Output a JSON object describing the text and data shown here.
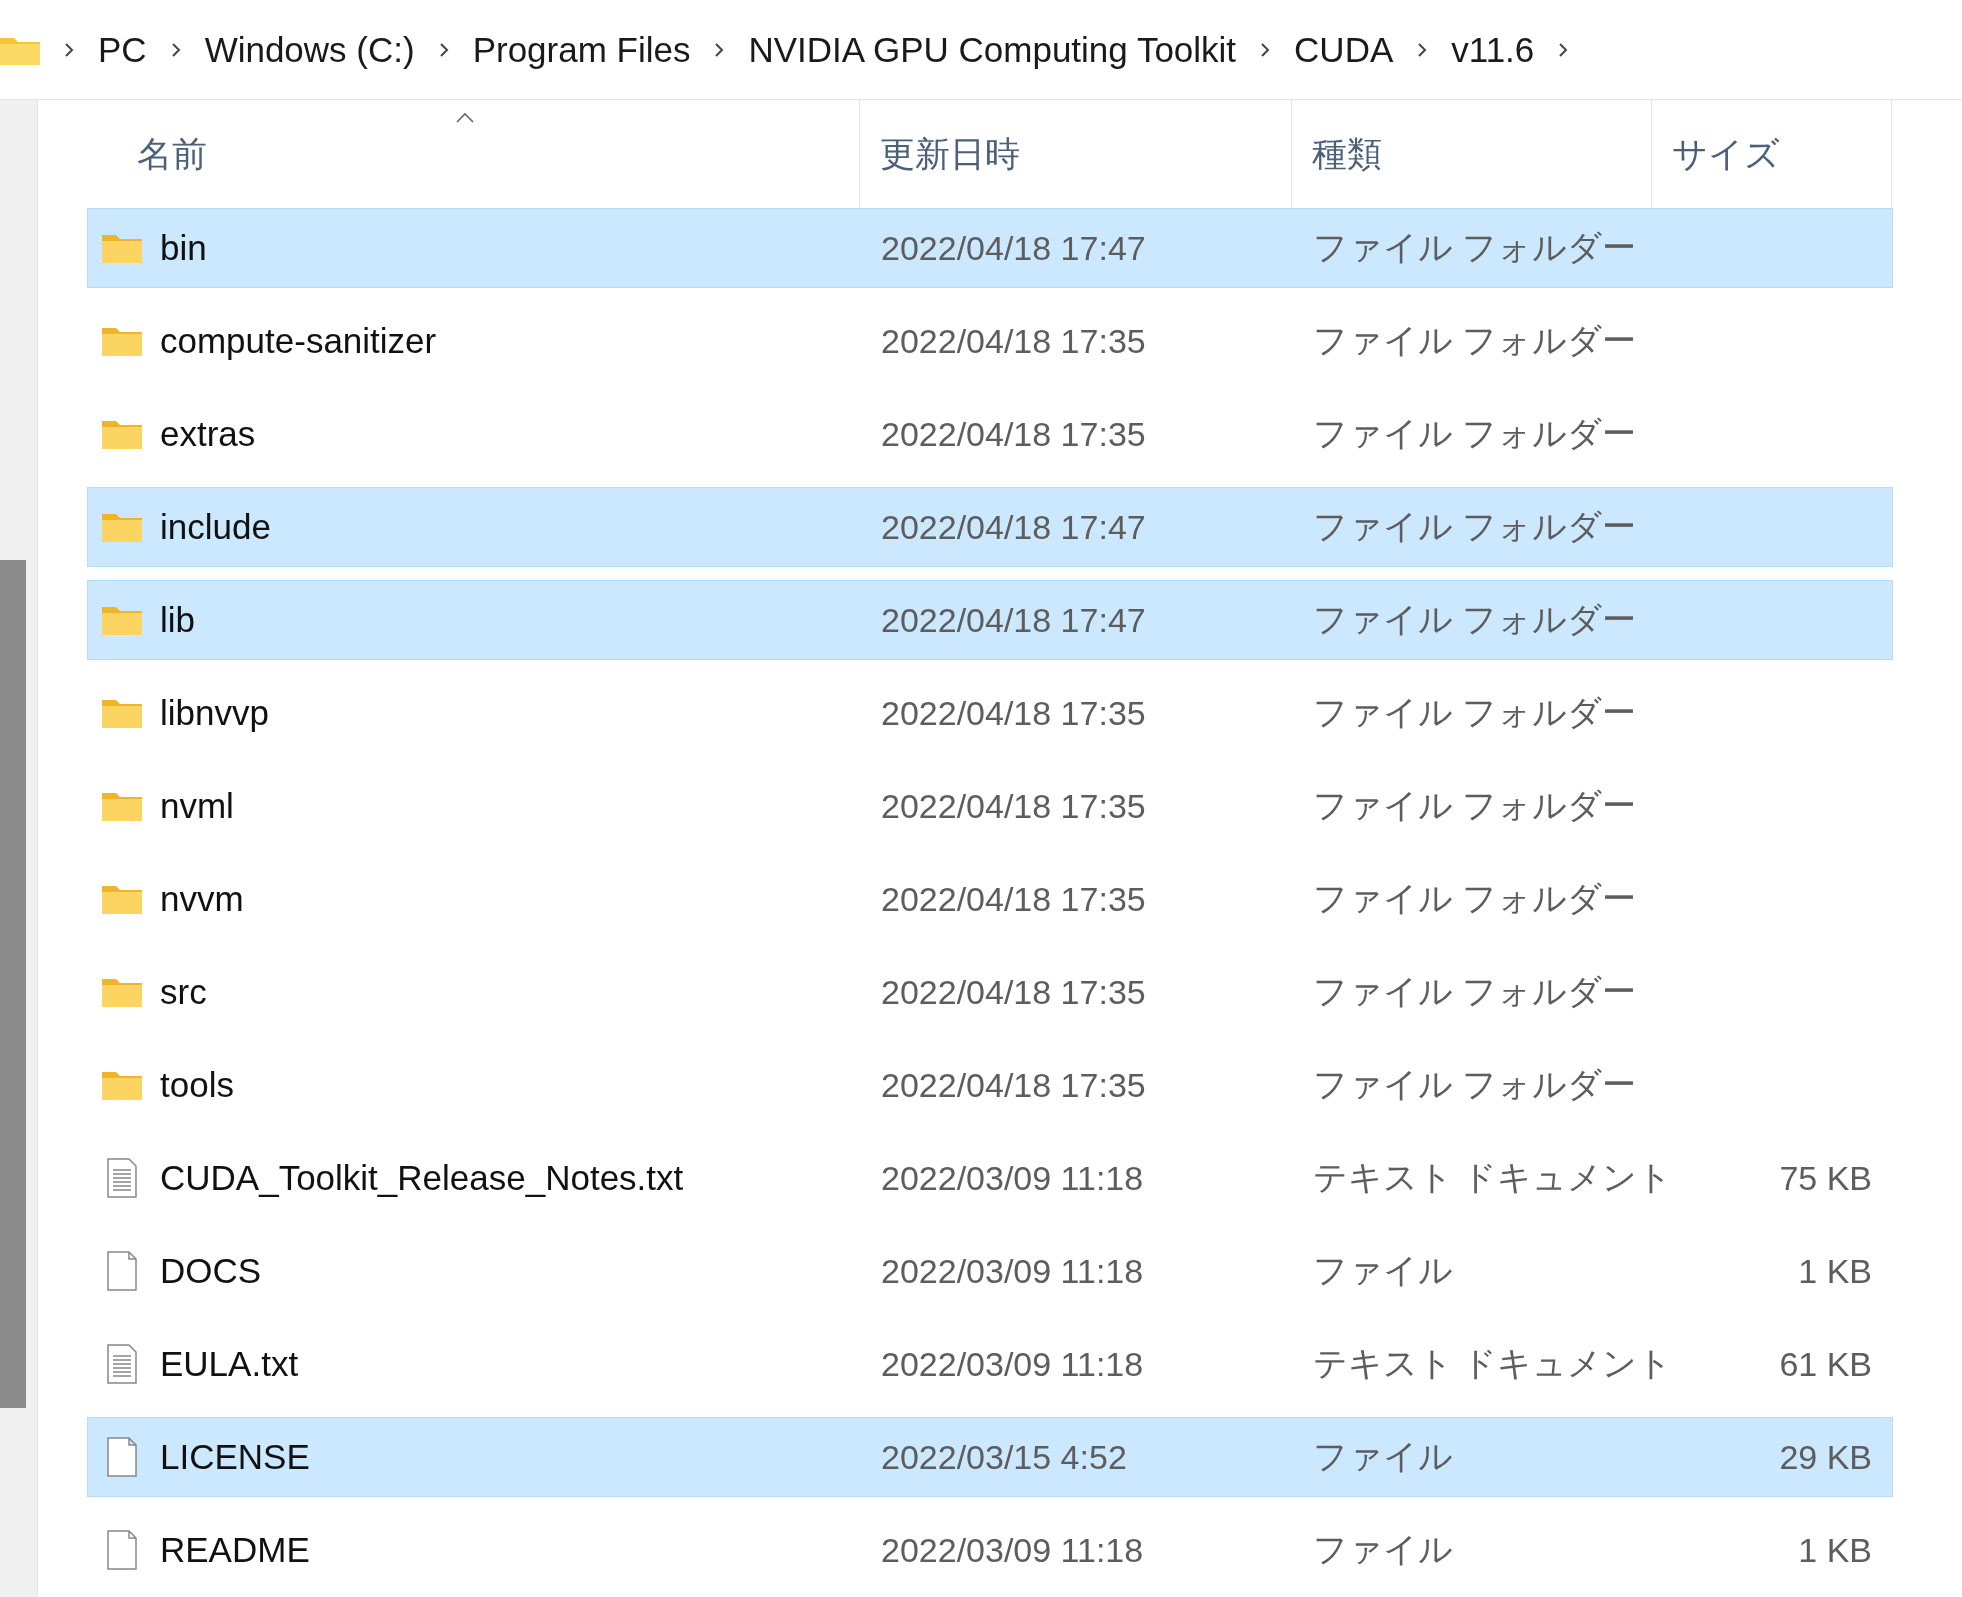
{
  "breadcrumb": [
    "PC",
    "Windows (C:)",
    "Program Files",
    "NVIDIA GPU Computing Toolkit",
    "CUDA",
    "v11.6"
  ],
  "table": {
    "columns": [
      {
        "label": "名前",
        "sorted": true
      },
      {
        "label": "更新日時",
        "sorted": false
      },
      {
        "label": "種類",
        "sorted": false
      },
      {
        "label": "サイズ",
        "sorted": false
      }
    ],
    "rows": [
      {
        "kind": "folder",
        "name": "bin",
        "date": "2022/04/18 17:47",
        "type": "ファイル フォルダー",
        "size": "",
        "selected": true
      },
      {
        "kind": "folder",
        "name": "compute-sanitizer",
        "date": "2022/04/18 17:35",
        "type": "ファイル フォルダー",
        "size": "",
        "selected": false
      },
      {
        "kind": "folder",
        "name": "extras",
        "date": "2022/04/18 17:35",
        "type": "ファイル フォルダー",
        "size": "",
        "selected": false
      },
      {
        "kind": "folder",
        "name": "include",
        "date": "2022/04/18 17:47",
        "type": "ファイル フォルダー",
        "size": "",
        "selected": true
      },
      {
        "kind": "folder",
        "name": "lib",
        "date": "2022/04/18 17:47",
        "type": "ファイル フォルダー",
        "size": "",
        "selected": true
      },
      {
        "kind": "folder",
        "name": "libnvvp",
        "date": "2022/04/18 17:35",
        "type": "ファイル フォルダー",
        "size": "",
        "selected": false
      },
      {
        "kind": "folder",
        "name": "nvml",
        "date": "2022/04/18 17:35",
        "type": "ファイル フォルダー",
        "size": "",
        "selected": false
      },
      {
        "kind": "folder",
        "name": "nvvm",
        "date": "2022/04/18 17:35",
        "type": "ファイル フォルダー",
        "size": "",
        "selected": false
      },
      {
        "kind": "folder",
        "name": "src",
        "date": "2022/04/18 17:35",
        "type": "ファイル フォルダー",
        "size": "",
        "selected": false
      },
      {
        "kind": "folder",
        "name": "tools",
        "date": "2022/04/18 17:35",
        "type": "ファイル フォルダー",
        "size": "",
        "selected": false
      },
      {
        "kind": "text",
        "name": "CUDA_Toolkit_Release_Notes.txt",
        "date": "2022/03/09 11:18",
        "type": "テキスト ドキュメント",
        "size": "75 KB",
        "selected": false
      },
      {
        "kind": "file",
        "name": "DOCS",
        "date": "2022/03/09 11:18",
        "type": "ファイル",
        "size": "1 KB",
        "selected": false
      },
      {
        "kind": "text",
        "name": "EULA.txt",
        "date": "2022/03/09 11:18",
        "type": "テキスト ドキュメント",
        "size": "61 KB",
        "selected": false
      },
      {
        "kind": "file",
        "name": "LICENSE",
        "date": "2022/03/15 4:52",
        "type": "ファイル",
        "size": "29 KB",
        "selected": true
      },
      {
        "kind": "file",
        "name": "README",
        "date": "2022/03/09 11:18",
        "type": "ファイル",
        "size": "1 KB",
        "selected": false
      }
    ]
  }
}
